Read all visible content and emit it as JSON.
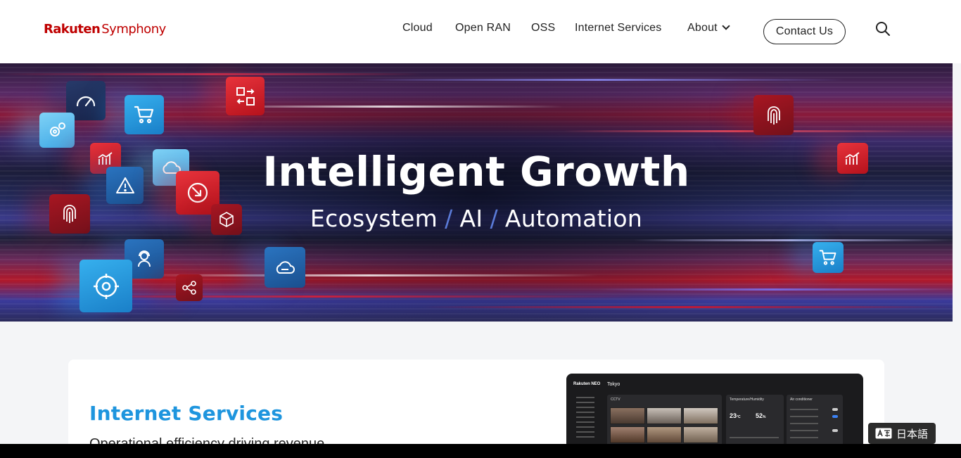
{
  "header": {
    "logo_brand": "Rakuten",
    "logo_product": "Symphony",
    "nav": [
      "Cloud",
      "Open RAN",
      "OSS",
      "Internet Services",
      "About"
    ],
    "contact_label": "Contact Us"
  },
  "hero": {
    "title": "Intelligent Growth",
    "subtitle_parts": [
      "Ecosystem",
      "/",
      "AI",
      "/",
      "Automation"
    ]
  },
  "card": {
    "title": "Internet Services",
    "subtitle": "Operational efficiency driving revenue",
    "dashboard": {
      "logo": "Rakuten NEO",
      "location": "Tokyo",
      "panels": [
        "CCTV",
        "Temperature/Humidity",
        "Air conditioner"
      ],
      "temperature": "23",
      "temperature_unit": "°C",
      "humidity": "52",
      "humidity_unit": "%"
    }
  },
  "language_button": "日本語",
  "colors": {
    "brand_red": "#bf0000",
    "accent_blue": "#1e95de",
    "hero_separator": "#5b7bd8"
  },
  "icons": [
    "search-icon",
    "chevron-down-icon",
    "translate-icon",
    "gauge-icon",
    "cart-icon",
    "arrows-swap-icon",
    "settings-icon",
    "chart-icon",
    "cloud-icon",
    "warning-icon",
    "shrink-icon",
    "cube-icon",
    "fingerprint-icon",
    "person-headset-icon",
    "wrench-gear-icon",
    "network-icon"
  ]
}
